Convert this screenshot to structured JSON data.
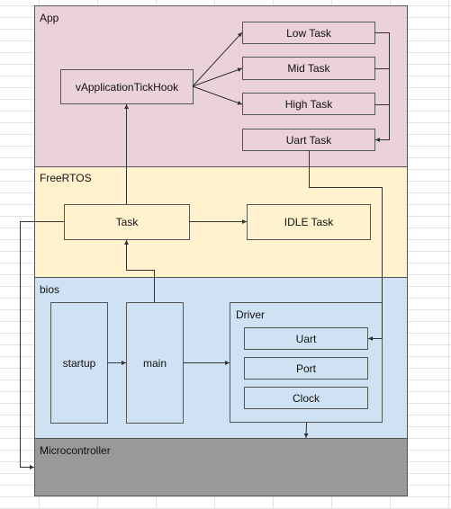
{
  "colors": {
    "app_layer": "#ead1dc",
    "freertos_layer": "#fff2cc",
    "bios_layer": "#cfe2f3",
    "microcontroller_layer": "#999999",
    "border": "#555555"
  },
  "layers": {
    "app": {
      "label": "App"
    },
    "freertos": {
      "label": "FreeRTOS"
    },
    "bios": {
      "label": "bios"
    },
    "microcontroller": {
      "label": "Microcontroller"
    }
  },
  "app": {
    "tick_hook": "vApplicationTickHook",
    "low_task": "Low Task",
    "mid_task": "Mid Task",
    "high_task": "High Task",
    "uart_task": "Uart Task"
  },
  "freertos": {
    "task": "Task",
    "idle_task": "IDLE Task"
  },
  "bios": {
    "startup": "startup",
    "main": "main",
    "driver": {
      "label": "Driver",
      "uart": "Uart",
      "port": "Port",
      "clock": "Clock"
    }
  }
}
